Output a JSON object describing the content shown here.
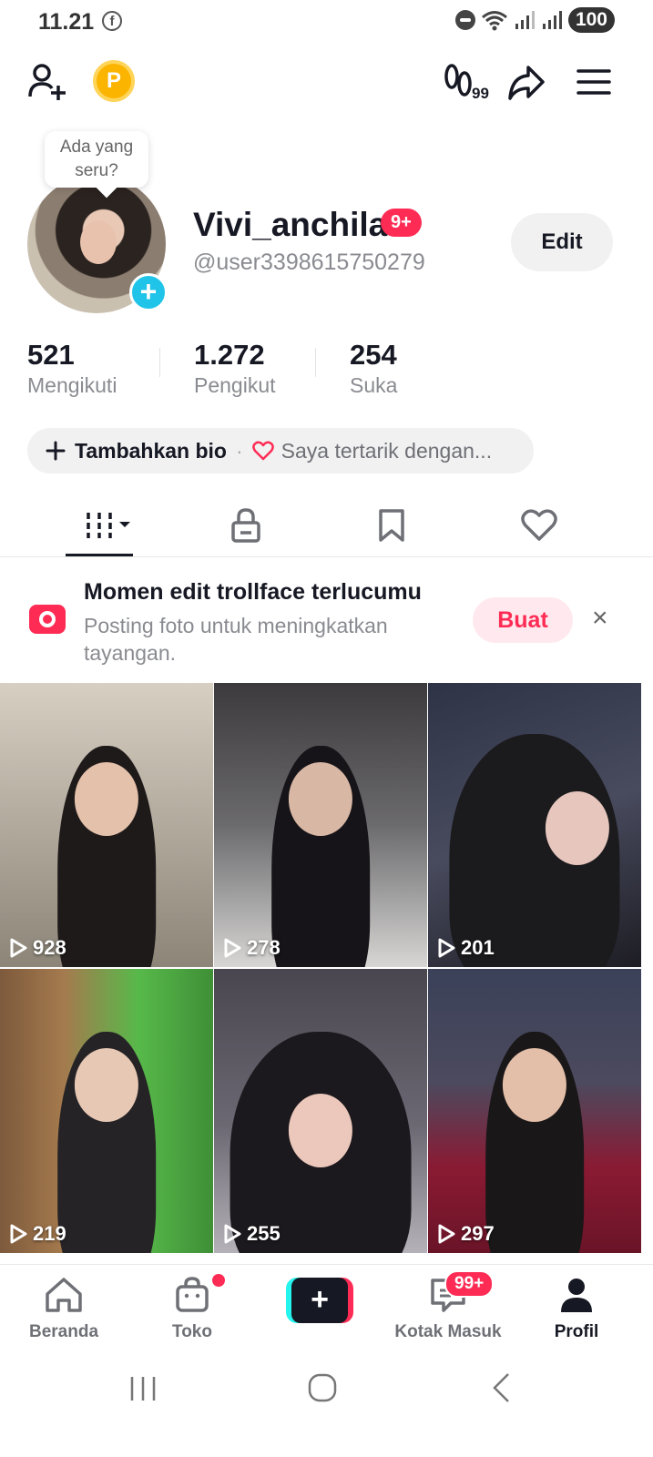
{
  "status_bar": {
    "time": "11.21",
    "battery": "100"
  },
  "profile": {
    "tooltip": "Ada yang seru?",
    "name": "Vivi_anchila",
    "badge": "9+",
    "handle": "@user3398615750279",
    "edit_label": "Edit"
  },
  "stats": [
    {
      "value": "521",
      "label": "Mengikuti"
    },
    {
      "value": "1.272",
      "label": "Pengikut"
    },
    {
      "value": "254",
      "label": "Suka"
    }
  ],
  "bio": {
    "add_label": "Tambahkan bio",
    "interest_label": "Saya tertarik dengan..."
  },
  "banner": {
    "title": "Momen edit trollface terlucumu",
    "subtitle": "Posting foto untuk meningkatkan tayangan.",
    "cta": "Buat",
    "close": "×"
  },
  "videos": [
    {
      "views": "928"
    },
    {
      "views": "278"
    },
    {
      "views": "201"
    },
    {
      "views": "219"
    },
    {
      "views": "255"
    },
    {
      "views": "297"
    }
  ],
  "bottom_nav": {
    "home": "Beranda",
    "shop": "Toko",
    "create": "+",
    "inbox": "Kotak Masuk",
    "inbox_badge": "99+",
    "profile": "Profil"
  },
  "colors": {
    "accent": "#fe2c55",
    "cyan": "#25f4ee",
    "text": "#161823",
    "muted": "#8a8b91"
  }
}
